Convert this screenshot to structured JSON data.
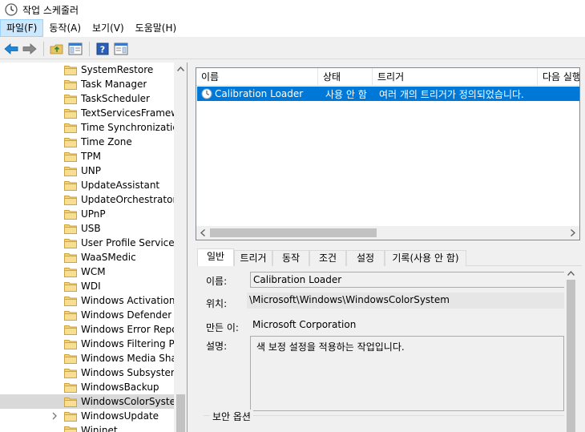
{
  "window": {
    "title": "작업 스케줄러"
  },
  "menu": [
    {
      "label": "파일(F)",
      "active": true
    },
    {
      "label": "동작(A)"
    },
    {
      "label": "보기(V)"
    },
    {
      "label": "도움말(H)"
    }
  ],
  "toolbar": {
    "buttons": [
      "back-arrow-icon",
      "forward-arrow-icon",
      "up-folder-icon",
      "show-hide-console-tree-icon",
      "help-icon",
      "show-hide-action-pane-icon"
    ]
  },
  "tree": {
    "items": [
      "SystemRestore",
      "Task Manager",
      "TaskScheduler",
      "TextServicesFramewo",
      "Time Synchronizatio",
      "Time Zone",
      "TPM",
      "UNP",
      "UpdateAssistant",
      "UpdateOrchestrator",
      "UPnP",
      "USB",
      "User Profile Service",
      "WaaSMedic",
      "WCM",
      "WDI",
      "Windows Activation T",
      "Windows Defender",
      "Windows Error Repor",
      "Windows Filtering Pla",
      "Windows Media Shar",
      "Windows Subsystem",
      "WindowsBackup",
      "WindowsColorSystem",
      "WindowsUpdate",
      "Wininet"
    ],
    "selected": "WindowsColorSystem"
  },
  "tasklist": {
    "columns": [
      "이름",
      "상태",
      "트리거",
      "다음 실행"
    ],
    "rows": [
      {
        "name": "Calibration Loader",
        "status": "사용 안 함",
        "trigger": "여러 개의 트리거가 정의되었습니다."
      }
    ]
  },
  "tabs": [
    "일반",
    "트리거",
    "동작",
    "조건",
    "설정",
    "기록(사용 안 함)"
  ],
  "active_tab": "일반",
  "general": {
    "name_label": "이름:",
    "name_value": "Calibration Loader",
    "location_label": "위치:",
    "location_value": "\\Microsoft\\Windows\\WindowsColorSystem",
    "author_label": "만든 이:",
    "author_value": "Microsoft Corporation",
    "description_label": "설명:",
    "description_value": "색 보정 설정을 적용하는 작업입니다.",
    "security_section": "보안 옵션"
  }
}
